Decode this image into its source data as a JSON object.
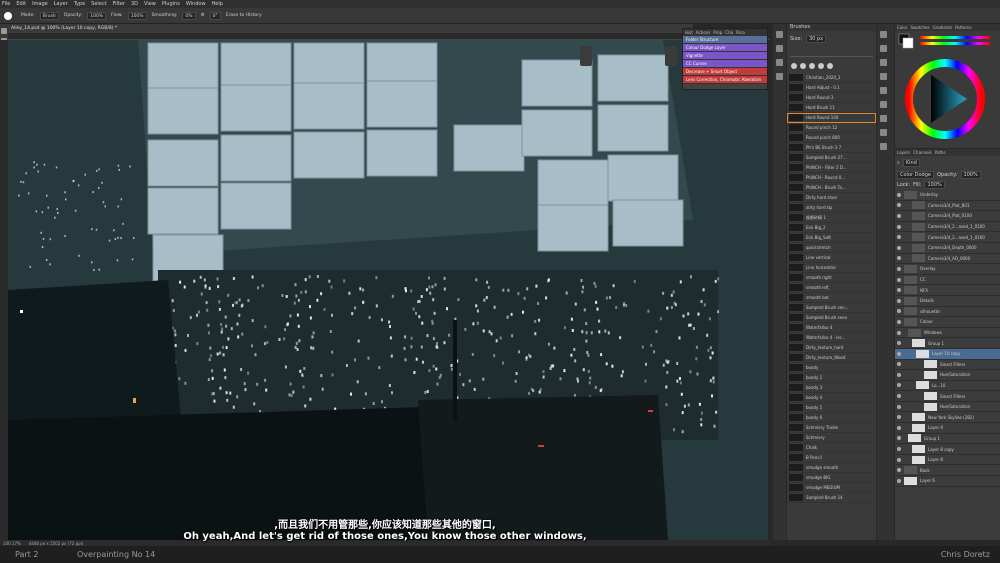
{
  "menu": [
    "File",
    "Edit",
    "Image",
    "Layer",
    "Type",
    "Select",
    "Filter",
    "3D",
    "View",
    "Plugins",
    "Window",
    "Help"
  ],
  "options": {
    "mode_label": "Mode:",
    "mode_value": "Brush",
    "opacity_label": "Opacity:",
    "opacity_value": "100%",
    "flow_label": "Flow:",
    "flow_value": "100%",
    "smoothing_label": "Smoothing:",
    "smoothing_value": "0%",
    "angle_value": "0°",
    "erase_history_label": "Erase to History"
  },
  "document_tab": "Alley_14.psd @ 100% (Layer 10 copy, RGB/8) *",
  "status": {
    "zoom": "100.17%",
    "doc_info": "4448 px x 2502 px (72 ppi)"
  },
  "footer": {
    "part": "Part 2",
    "title": "Overpainting No 14",
    "author": "Chris Doretz"
  },
  "subtitles": {
    "chinese": ",而且我们不用管那些,你应该知道那些其他的窗口,",
    "english": "Oh yeah,And let's get rid of those ones,You know those other windows,"
  },
  "actions_panel": {
    "tabs": [
      "Hist",
      "Actions",
      "Prop",
      "Cha",
      "Para"
    ],
    "items": [
      {
        "label": "Folder Structure",
        "color": "#5a6e9a"
      },
      {
        "label": "Colour Dodge Layer",
        "color": "#7a56c8"
      },
      {
        "label": "Vignette",
        "color": "#7a56c8"
      },
      {
        "label": "CC Curves",
        "color": "#7a56c8"
      },
      {
        "label": "Decrease + Smart Object",
        "color": "#c23b3b"
      },
      {
        "label": "Lens Correction, Chromatic Aberation",
        "color": "#c23b3b"
      }
    ]
  },
  "brushes_panel": {
    "title": "Brushes",
    "size_label": "Size:",
    "size_value": "30 px",
    "items": [
      "Christian_2020_2",
      "Hard Adjust - 0.1",
      "Hard Round 3",
      "Hard Brush 11",
      "Hard Round 100",
      "Round pinch 12",
      "Round pinch 800",
      "Ph's BE Brush 3 7",
      "Sampled Brush 27...",
      "PhiNCH - Filter 2 D...",
      "PhiNCH - Round 0...",
      "PhiNCH - Brush Ta...",
      "Dirty hard shoe",
      "dirty hard tip",
      "偷孵砂精 1",
      "Enk Big_2",
      "Enk Big_Soft",
      "quickstretch",
      "Line vertical",
      "Line horizontal",
      "smooth right",
      "smooth left",
      "smooth bot",
      "Sampled Brush sen...",
      "Sampled Brush seen",
      "Waterfallso 4",
      "Waterfallso 4 - ler...",
      "Dirty_texture_hard",
      "Dirty_texture_Wood",
      "boody",
      "boody 2",
      "boody 3",
      "boody 4",
      "boody 5",
      "boody 6",
      "Schmiery Tradie",
      "Schmiery",
      "Chalk",
      "B Pencil",
      "smudge smooth",
      "smudge BIG",
      "smudge MEDIUM",
      "Sampled Brush 14"
    ]
  },
  "color_panel": {
    "tabs": [
      "Color",
      "Swatches",
      "Gradients",
      "Patterns"
    ]
  },
  "layers_panel": {
    "tabs": [
      "Layers",
      "Channels",
      "Paths"
    ],
    "search_placeholder": "Kind",
    "blend_mode": "Color Dodge",
    "opacity_label": "Opacity:",
    "opacity_value": "100%",
    "fill_label": "Fill:",
    "fill_value": "100%",
    "lock_label": "Lock:",
    "items": [
      "Underlay",
      "Camera3/4_Plat_B01",
      "Camera3/4_Plat_0100",
      "Camera3/4_2...ased_1_0100",
      "Camera3/4_2...ased_1_0100",
      "Camera3/4_Depth_0000",
      "Camera3/4_AO_0000",
      "Overlay",
      "CC",
      "NFX",
      "Details",
      "silhouette",
      "Colour",
      "Windows",
      "Group 1",
      "Layer 10 copy",
      "Smart Filters",
      "Hue/Saturation",
      "Lo...10",
      "Smart Filters",
      "Hue/Saturation",
      "New York Skyline (282)",
      "Layer 9",
      "Group 1",
      "Layer 8 copy",
      "Layer 8",
      "Back",
      "Layer 6"
    ]
  },
  "colors": {
    "canvas_bg": "#26393d",
    "window_panel": "#a7bdc7",
    "accent_selected": "#e08a2e"
  }
}
